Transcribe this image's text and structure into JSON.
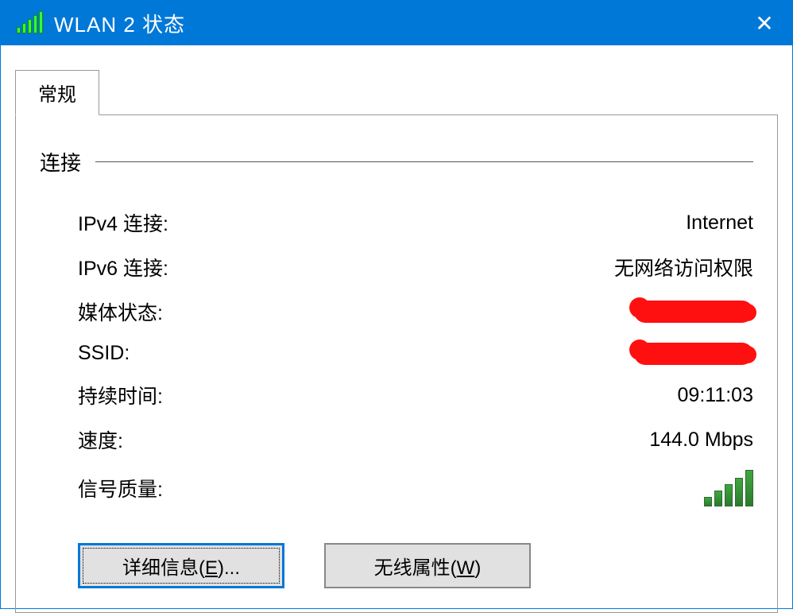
{
  "titlebar": {
    "title": "WLAN 2 状态"
  },
  "tabs": {
    "general": "常规"
  },
  "section": {
    "connection": "连接"
  },
  "fields": {
    "ipv4_label": "IPv4 连接:",
    "ipv4_value": "Internet",
    "ipv6_label": "IPv6 连接:",
    "ipv6_value": "无网络访问权限",
    "media_state_label": "媒体状态:",
    "ssid_label": "SSID:",
    "duration_label": "持续时间:",
    "duration_value": "09:11:03",
    "speed_label": "速度:",
    "speed_value": "144.0 Mbps",
    "signal_quality_label": "信号质量:"
  },
  "buttons": {
    "details_pre": "详细信息(",
    "details_key": "E",
    "details_post": ")...",
    "wireless_props_pre": "无线属性(",
    "wireless_props_key": "W",
    "wireless_props_post": ")"
  }
}
